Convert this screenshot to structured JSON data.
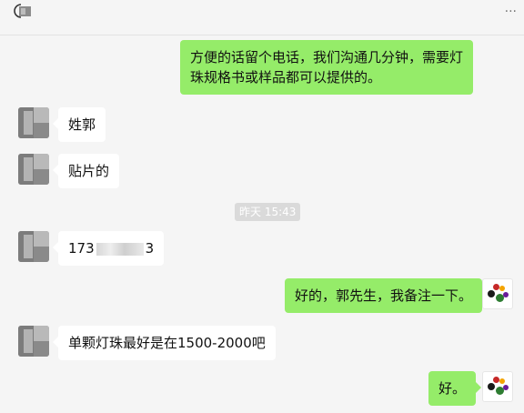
{
  "colors": {
    "background": "#f5f5f5",
    "bubble_outgoing": "#95ec69",
    "bubble_incoming": "#ffffff",
    "timestamp_bg": "#dadada"
  },
  "header": {
    "icon": "conversation-icon",
    "more_icon": "more-icon",
    "more_text": "···"
  },
  "messages": [
    {
      "from": "self",
      "text": "方便的话留个电话，我们沟通几分钟，需要灯珠规格书或样品都可以提供的。"
    },
    {
      "from": "peer",
      "text": "姓郭"
    },
    {
      "from": "peer",
      "text": "贴片的"
    },
    {
      "from": "peer",
      "text_start": "173",
      "text_end": "3",
      "redacted": true
    },
    {
      "from": "self",
      "text": "好的，郭先生，我备注一下。"
    },
    {
      "from": "peer",
      "text": "单颗灯珠最好是在1500-2000吧"
    },
    {
      "from": "self",
      "text": "好。"
    }
  ],
  "timestamp": "昨天 15:43"
}
